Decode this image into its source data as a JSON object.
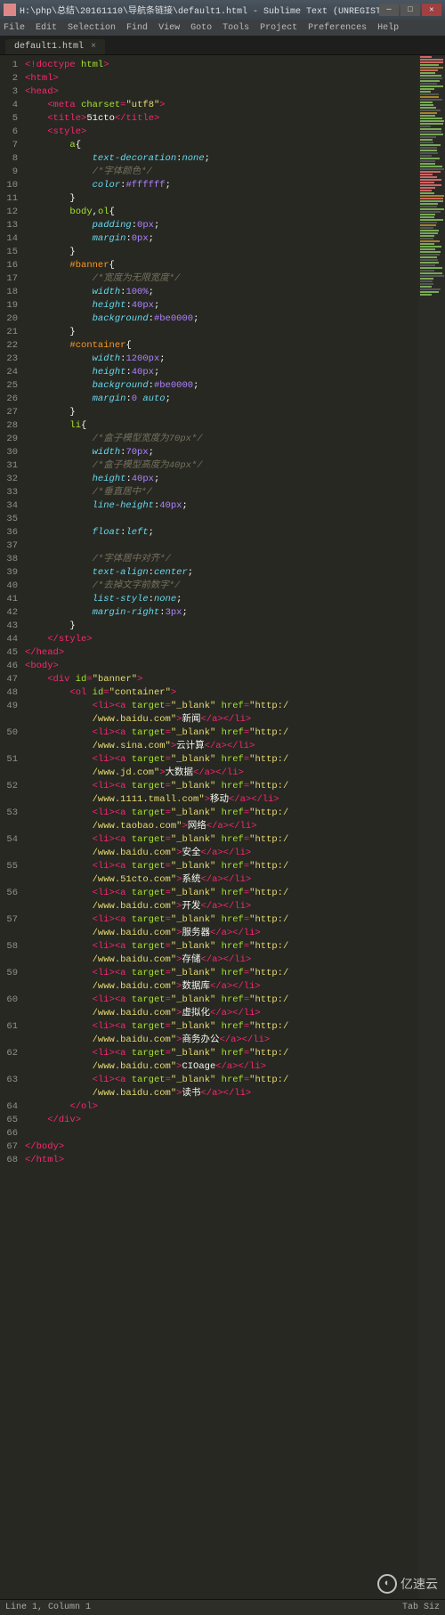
{
  "window": {
    "title": "H:\\php\\总结\\20161110\\导航条链接\\default1.html - Sublime Text (UNREGISTERED)"
  },
  "menu": [
    "File",
    "Edit",
    "Selection",
    "Find",
    "View",
    "Goto",
    "Tools",
    "Project",
    "Preferences",
    "Help"
  ],
  "tab": {
    "label": "default1.html"
  },
  "status": {
    "left": "Line 1, Column 1",
    "right": "Tab Siz"
  },
  "watermark": "亿速云",
  "lines": [
    {
      "n": 1,
      "h": "<span class='p'>&lt;!</span><span class='t'>doctype</span> <span class='a'>html</span><span class='p'>&gt;</span>"
    },
    {
      "n": 2,
      "h": "<span class='p'>&lt;</span><span class='t'>html</span><span class='p'>&gt;</span>"
    },
    {
      "n": 3,
      "h": "<span class='p'>&lt;</span><span class='t'>head</span><span class='p'>&gt;</span>"
    },
    {
      "n": 4,
      "h": "    <span class='p'>&lt;</span><span class='t'>meta</span> <span class='a'>charset</span><span class='op'>=</span><span class='s'>\"utf8\"</span><span class='p'>&gt;</span>"
    },
    {
      "n": 5,
      "h": "    <span class='p'>&lt;</span><span class='t'>title</span><span class='p'>&gt;</span><span class='w'>51cto</span><span class='p'>&lt;/</span><span class='t'>title</span><span class='p'>&gt;</span>"
    },
    {
      "n": 6,
      "h": "    <span class='p'>&lt;</span><span class='t'>style</span><span class='p'>&gt;</span>"
    },
    {
      "n": 7,
      "h": "        <span class='sel'>a</span><span class='w'>{</span>"
    },
    {
      "n": 8,
      "h": "            <span class='k'>text-decoration</span><span class='w'>:</span><span class='k'>none</span><span class='w'>;</span>"
    },
    {
      "n": 9,
      "h": "            <span class='c'>/*字体颜色*/</span>"
    },
    {
      "n": 10,
      "h": "            <span class='k'>color</span><span class='w'>:</span><span class='n'>#ffffff</span><span class='w'>;</span>"
    },
    {
      "n": 11,
      "h": "        <span class='w'>}</span>"
    },
    {
      "n": 12,
      "h": "        <span class='sel'>body</span><span class='w'>,</span><span class='sel'>ol</span><span class='w'>{</span>"
    },
    {
      "n": 13,
      "h": "            <span class='k'>padding</span><span class='w'>:</span><span class='n'>0px</span><span class='w'>;</span>"
    },
    {
      "n": 14,
      "h": "            <span class='k'>margin</span><span class='w'>:</span><span class='n'>0px</span><span class='w'>;</span>"
    },
    {
      "n": 15,
      "h": "        <span class='w'>}</span>"
    },
    {
      "n": 16,
      "h": "        <span class='id'>#banner</span><span class='w'>{</span>"
    },
    {
      "n": 17,
      "h": "            <span class='c'>/*宽度为无限宽度*/</span>"
    },
    {
      "n": 18,
      "h": "            <span class='k'>width</span><span class='w'>:</span><span class='n'>100%</span><span class='w'>;</span>"
    },
    {
      "n": 19,
      "h": "            <span class='k'>height</span><span class='w'>:</span><span class='n'>40px</span><span class='w'>;</span>"
    },
    {
      "n": 20,
      "h": "            <span class='k'>background</span><span class='w'>:</span><span class='n'>#be0000</span><span class='w'>;</span>"
    },
    {
      "n": 21,
      "h": "        <span class='w'>}</span>"
    },
    {
      "n": 22,
      "h": "        <span class='id'>#container</span><span class='w'>{</span>"
    },
    {
      "n": 23,
      "h": "            <span class='k'>width</span><span class='w'>:</span><span class='n'>1200px</span><span class='w'>;</span>"
    },
    {
      "n": 24,
      "h": "            <span class='k'>height</span><span class='w'>:</span><span class='n'>40px</span><span class='w'>;</span>"
    },
    {
      "n": 25,
      "h": "            <span class='k'>background</span><span class='w'>:</span><span class='n'>#be0000</span><span class='w'>;</span>"
    },
    {
      "n": 26,
      "h": "            <span class='k'>margin</span><span class='w'>:</span><span class='n'>0</span> <span class='k'>auto</span><span class='w'>;</span>"
    },
    {
      "n": 27,
      "h": "        <span class='w'>}</span>"
    },
    {
      "n": 28,
      "h": "        <span class='sel'>li</span><span class='w'>{</span>"
    },
    {
      "n": 29,
      "h": "            <span class='c'>/*盒子模型宽度为70px*/</span>"
    },
    {
      "n": 30,
      "h": "            <span class='k'>width</span><span class='w'>:</span><span class='n'>70px</span><span class='w'>;</span>"
    },
    {
      "n": 31,
      "h": "            <span class='c'>/*盒子模型高度为40px*/</span>"
    },
    {
      "n": 32,
      "h": "            <span class='k'>height</span><span class='w'>:</span><span class='n'>40px</span><span class='w'>;</span>"
    },
    {
      "n": 33,
      "h": "            <span class='c'>/*垂直居中*/</span>"
    },
    {
      "n": 34,
      "h": "            <span class='k'>line-height</span><span class='w'>:</span><span class='n'>40px</span><span class='w'>;</span>"
    },
    {
      "n": 35,
      "h": ""
    },
    {
      "n": 36,
      "h": "            <span class='k'>float</span><span class='w'>:</span><span class='k'>left</span><span class='w'>;</span>"
    },
    {
      "n": 37,
      "h": ""
    },
    {
      "n": 38,
      "h": "            <span class='c'>/*字体居中对齐*/</span>"
    },
    {
      "n": 39,
      "h": "            <span class='k'>text-align</span><span class='w'>:</span><span class='k'>center</span><span class='w'>;</span>"
    },
    {
      "n": 40,
      "h": "            <span class='c'>/*去掉文字前数字*/</span>"
    },
    {
      "n": 41,
      "h": "            <span class='k'>list-style</span><span class='w'>:</span><span class='k'>none</span><span class='w'>;</span>"
    },
    {
      "n": 42,
      "h": "            <span class='k'>margin-right</span><span class='w'>:</span><span class='n'>3px</span><span class='w'>;</span>"
    },
    {
      "n": 43,
      "h": "        <span class='w'>}</span>"
    },
    {
      "n": 44,
      "h": "    <span class='p'>&lt;/</span><span class='t'>style</span><span class='p'>&gt;</span>"
    },
    {
      "n": 45,
      "h": "<span class='p'>&lt;/</span><span class='t'>head</span><span class='p'>&gt;</span>"
    },
    {
      "n": 46,
      "h": "<span class='p'>&lt;</span><span class='t'>body</span><span class='p'>&gt;</span>"
    },
    {
      "n": 47,
      "h": "    <span class='p'>&lt;</span><span class='t'>div</span> <span class='a'>id</span><span class='op'>=</span><span class='s'>\"banner\"</span><span class='p'>&gt;</span>"
    },
    {
      "n": 48,
      "h": "        <span class='p'>&lt;</span><span class='t'>ol</span> <span class='a'>id</span><span class='op'>=</span><span class='s'>\"container\"</span><span class='p'>&gt;</span>"
    },
    {
      "n": 49,
      "h": "            <span class='p'>&lt;</span><span class='t'>li</span><span class='p'>&gt;&lt;</span><span class='t'>a</span> <span class='a'>target</span><span class='op'>=</span><span class='s'>\"_blank\"</span> <span class='a'>href</span><span class='op'>=</span><span class='s'>\"http:/</span><br>            <span class='s'>/www.baidu.com\"</span><span class='p'>&gt;</span><span class='w'>新闻</span><span class='p'>&lt;/</span><span class='t'>a</span><span class='p'>&gt;&lt;/</span><span class='t'>li</span><span class='p'>&gt;</span>"
    },
    {
      "n": 50,
      "h": "            <span class='p'>&lt;</span><span class='t'>li</span><span class='p'>&gt;&lt;</span><span class='t'>a</span> <span class='a'>target</span><span class='op'>=</span><span class='s'>\"_blank\"</span> <span class='a'>href</span><span class='op'>=</span><span class='s'>\"http:/</span><br>            <span class='s'>/www.sina.com\"</span><span class='p'>&gt;</span><span class='w'>云计算</span><span class='p'>&lt;/</span><span class='t'>a</span><span class='p'>&gt;&lt;/</span><span class='t'>li</span><span class='p'>&gt;</span>"
    },
    {
      "n": 51,
      "h": "            <span class='p'>&lt;</span><span class='t'>li</span><span class='p'>&gt;&lt;</span><span class='t'>a</span> <span class='a'>target</span><span class='op'>=</span><span class='s'>\"_blank\"</span> <span class='a'>href</span><span class='op'>=</span><span class='s'>\"http:/</span><br>            <span class='s'>/www.jd.com\"</span><span class='p'>&gt;</span><span class='w'>大数据</span><span class='p'>&lt;/</span><span class='t'>a</span><span class='p'>&gt;&lt;/</span><span class='t'>li</span><span class='p'>&gt;</span>"
    },
    {
      "n": 52,
      "h": "            <span class='p'>&lt;</span><span class='t'>li</span><span class='p'>&gt;&lt;</span><span class='t'>a</span> <span class='a'>target</span><span class='op'>=</span><span class='s'>\"_blank\"</span> <span class='a'>href</span><span class='op'>=</span><span class='s'>\"http:/</span><br>            <span class='s'>/www.1111.tmall.com\"</span><span class='p'>&gt;</span><span class='w'>移动</span><span class='p'>&lt;/</span><span class='t'>a</span><span class='p'>&gt;&lt;/</span><span class='t'>li</span><span class='p'>&gt;</span>"
    },
    {
      "n": 53,
      "h": "            <span class='p'>&lt;</span><span class='t'>li</span><span class='p'>&gt;&lt;</span><span class='t'>a</span> <span class='a'>target</span><span class='op'>=</span><span class='s'>\"_blank\"</span> <span class='a'>href</span><span class='op'>=</span><span class='s'>\"http:/</span><br>            <span class='s'>/www.taobao.com\"</span><span class='p'>&gt;</span><span class='w'>网络</span><span class='p'>&lt;/</span><span class='t'>a</span><span class='p'>&gt;&lt;/</span><span class='t'>li</span><span class='p'>&gt;</span>"
    },
    {
      "n": 54,
      "h": "            <span class='p'>&lt;</span><span class='t'>li</span><span class='p'>&gt;&lt;</span><span class='t'>a</span> <span class='a'>target</span><span class='op'>=</span><span class='s'>\"_blank\"</span> <span class='a'>href</span><span class='op'>=</span><span class='s'>\"http:/</span><br>            <span class='s'>/www.baidu.com\"</span><span class='p'>&gt;</span><span class='w'>安全</span><span class='p'>&lt;/</span><span class='t'>a</span><span class='p'>&gt;&lt;/</span><span class='t'>li</span><span class='p'>&gt;</span>"
    },
    {
      "n": 55,
      "h": "            <span class='p'>&lt;</span><span class='t'>li</span><span class='p'>&gt;&lt;</span><span class='t'>a</span> <span class='a'>target</span><span class='op'>=</span><span class='s'>\"_blank\"</span> <span class='a'>href</span><span class='op'>=</span><span class='s'>\"http:/</span><br>            <span class='s'>/www.51cto.com\"</span><span class='p'>&gt;</span><span class='w'>系统</span><span class='p'>&lt;/</span><span class='t'>a</span><span class='p'>&gt;&lt;/</span><span class='t'>li</span><span class='p'>&gt;</span>"
    },
    {
      "n": 56,
      "h": "            <span class='p'>&lt;</span><span class='t'>li</span><span class='p'>&gt;&lt;</span><span class='t'>a</span> <span class='a'>target</span><span class='op'>=</span><span class='s'>\"_blank\"</span> <span class='a'>href</span><span class='op'>=</span><span class='s'>\"http:/</span><br>            <span class='s'>/www.baidu.com\"</span><span class='p'>&gt;</span><span class='w'>开发</span><span class='p'>&lt;/</span><span class='t'>a</span><span class='p'>&gt;&lt;/</span><span class='t'>li</span><span class='p'>&gt;</span>"
    },
    {
      "n": 57,
      "h": "            <span class='p'>&lt;</span><span class='t'>li</span><span class='p'>&gt;&lt;</span><span class='t'>a</span> <span class='a'>target</span><span class='op'>=</span><span class='s'>\"_blank\"</span> <span class='a'>href</span><span class='op'>=</span><span class='s'>\"http:/</span><br>            <span class='s'>/www.baidu.com\"</span><span class='p'>&gt;</span><span class='w'>服务器</span><span class='p'>&lt;/</span><span class='t'>a</span><span class='p'>&gt;&lt;/</span><span class='t'>li</span><span class='p'>&gt;</span>"
    },
    {
      "n": 58,
      "h": "            <span class='p'>&lt;</span><span class='t'>li</span><span class='p'>&gt;&lt;</span><span class='t'>a</span> <span class='a'>target</span><span class='op'>=</span><span class='s'>\"_blank\"</span> <span class='a'>href</span><span class='op'>=</span><span class='s'>\"http:/</span><br>            <span class='s'>/www.baidu.com\"</span><span class='p'>&gt;</span><span class='w'>存储</span><span class='p'>&lt;/</span><span class='t'>a</span><span class='p'>&gt;&lt;/</span><span class='t'>li</span><span class='p'>&gt;</span>"
    },
    {
      "n": 59,
      "h": "            <span class='p'>&lt;</span><span class='t'>li</span><span class='p'>&gt;&lt;</span><span class='t'>a</span> <span class='a'>target</span><span class='op'>=</span><span class='s'>\"_blank\"</span> <span class='a'>href</span><span class='op'>=</span><span class='s'>\"http:/</span><br>            <span class='s'>/www.baidu.com\"</span><span class='p'>&gt;</span><span class='w'>数据库</span><span class='p'>&lt;/</span><span class='t'>a</span><span class='p'>&gt;&lt;/</span><span class='t'>li</span><span class='p'>&gt;</span>"
    },
    {
      "n": 60,
      "h": "            <span class='p'>&lt;</span><span class='t'>li</span><span class='p'>&gt;&lt;</span><span class='t'>a</span> <span class='a'>target</span><span class='op'>=</span><span class='s'>\"_blank\"</span> <span class='a'>href</span><span class='op'>=</span><span class='s'>\"http:/</span><br>            <span class='s'>/www.baidu.com\"</span><span class='p'>&gt;</span><span class='w'>虚拟化</span><span class='p'>&lt;/</span><span class='t'>a</span><span class='p'>&gt;&lt;/</span><span class='t'>li</span><span class='p'>&gt;</span>"
    },
    {
      "n": 61,
      "h": "            <span class='p'>&lt;</span><span class='t'>li</span><span class='p'>&gt;&lt;</span><span class='t'>a</span> <span class='a'>target</span><span class='op'>=</span><span class='s'>\"_blank\"</span> <span class='a'>href</span><span class='op'>=</span><span class='s'>\"http:/</span><br>            <span class='s'>/www.baidu.com\"</span><span class='p'>&gt;</span><span class='w'>商务办公</span><span class='p'>&lt;/</span><span class='t'>a</span><span class='p'>&gt;&lt;/</span><span class='t'>li</span><span class='p'>&gt;</span>"
    },
    {
      "n": 62,
      "h": "            <span class='p'>&lt;</span><span class='t'>li</span><span class='p'>&gt;&lt;</span><span class='t'>a</span> <span class='a'>target</span><span class='op'>=</span><span class='s'>\"_blank\"</span> <span class='a'>href</span><span class='op'>=</span><span class='s'>\"http:/</span><br>            <span class='s'>/www.baidu.com\"</span><span class='p'>&gt;</span><span class='w'>CIOage</span><span class='p'>&lt;/</span><span class='t'>a</span><span class='p'>&gt;&lt;/</span><span class='t'>li</span><span class='p'>&gt;</span>"
    },
    {
      "n": 63,
      "h": "            <span class='p'>&lt;</span><span class='t'>li</span><span class='p'>&gt;&lt;</span><span class='t'>a</span> <span class='a'>target</span><span class='op'>=</span><span class='s'>\"_blank\"</span> <span class='a'>href</span><span class='op'>=</span><span class='s'>\"http:/</span><br>            <span class='s'>/www.baidu.com\"</span><span class='p'>&gt;</span><span class='w'>读书</span><span class='p'>&lt;/</span><span class='t'>a</span><span class='p'>&gt;&lt;/</span><span class='t'>li</span><span class='p'>&gt;</span>"
    },
    {
      "n": 64,
      "h": "        <span class='p'>&lt;/</span><span class='t'>ol</span><span class='p'>&gt;</span>"
    },
    {
      "n": 65,
      "h": "    <span class='p'>&lt;/</span><span class='t'>div</span><span class='p'>&gt;</span>"
    },
    {
      "n": 66,
      "h": ""
    },
    {
      "n": 67,
      "h": "<span class='p'>&lt;/</span><span class='t'>body</span><span class='p'>&gt;</span>"
    },
    {
      "n": 68,
      "h": "<span class='p'>&lt;/</span><span class='t'>html</span><span class='p'>&gt;</span>"
    }
  ]
}
